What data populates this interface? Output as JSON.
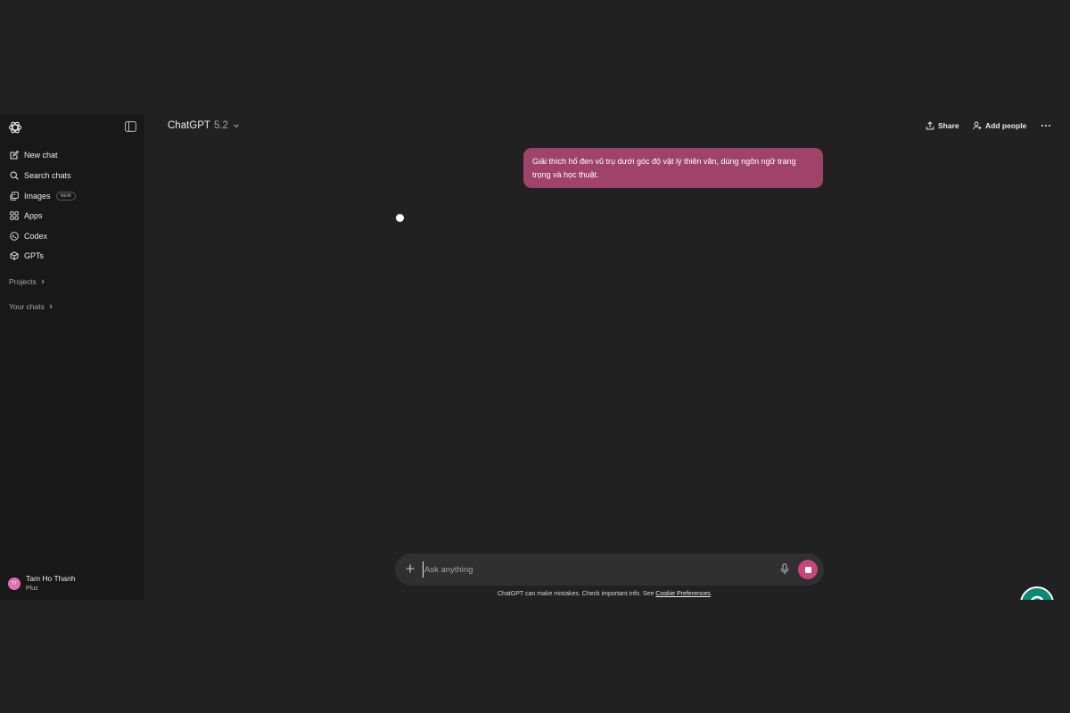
{
  "sidebar": {
    "items": [
      {
        "label": "New chat",
        "icon": "edit-icon"
      },
      {
        "label": "Search chats",
        "icon": "search-icon"
      },
      {
        "label": "Images",
        "icon": "images-icon",
        "badge": "NEW"
      },
      {
        "label": "Apps",
        "icon": "apps-icon"
      },
      {
        "label": "Codex",
        "icon": "codex-icon"
      },
      {
        "label": "GPTs",
        "icon": "cube-icon"
      }
    ],
    "sections": {
      "projects": "Projects",
      "your_chats": "Your chats"
    },
    "user": {
      "name": "Tam Ho Thanh",
      "plan": "Plus",
      "initials": "TT"
    }
  },
  "header": {
    "title": "ChatGPT",
    "version": "5.2",
    "share_label": "Share",
    "add_people_label": "Add people"
  },
  "conversation": {
    "user_message": "Giải thích hố đen vũ trụ dưới góc độ vật lý thiên văn, dùng ngôn ngữ trang trọng và học thuật."
  },
  "composer": {
    "placeholder": "Ask anything",
    "value": ""
  },
  "footer": {
    "disclaimer": "ChatGPT can make mistakes. Check important info. See ",
    "link": "Cookie Preferences",
    "end": "."
  },
  "colors": {
    "accent": "#c6457e",
    "bubble": "#a0436a",
    "sidebar_bg": "#181818",
    "main_bg": "#212121"
  }
}
